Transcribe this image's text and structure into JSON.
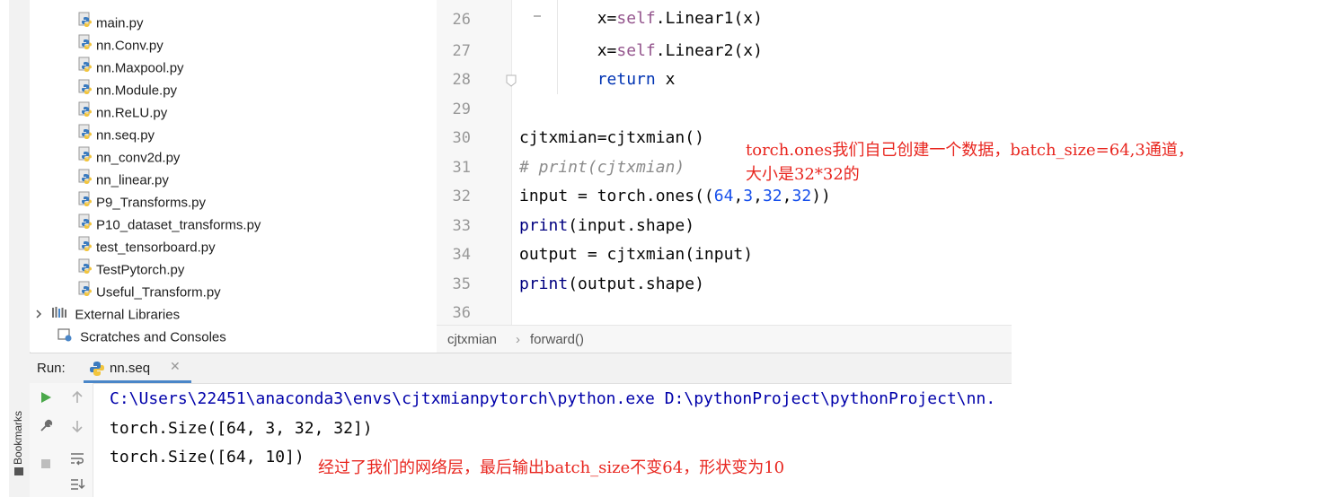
{
  "project_tree": {
    "files": [
      {
        "label": "main.py"
      },
      {
        "label": "nn.Conv.py"
      },
      {
        "label": "nn.Maxpool.py"
      },
      {
        "label": "nn.Module.py"
      },
      {
        "label": "nn.ReLU.py"
      },
      {
        "label": "nn.seq.py"
      },
      {
        "label": "nn_conv2d.py"
      },
      {
        "label": "nn_linear.py"
      },
      {
        "label": "P9_Transforms.py"
      },
      {
        "label": "P10_dataset_transforms.py"
      },
      {
        "label": "test_tensorboard.py"
      },
      {
        "label": "TestPytorch.py"
      },
      {
        "label": "Useful_Transform.py"
      }
    ],
    "external_libraries": "External Libraries",
    "scratches": "Scratches and Consoles"
  },
  "editor": {
    "line_numbers": [
      "26",
      "27",
      "28",
      "29",
      "30",
      "31",
      "32",
      "33",
      "34",
      "35",
      "36"
    ],
    "code": {
      "l26_indent": "        ",
      "l26_var": "x=",
      "l26_self": "self",
      "l26_rest": ".Linear1(x)",
      "l27_indent": "        ",
      "l27_var": "x=",
      "l27_self": "self",
      "l27_rest": ".Linear2(x)",
      "l28_indent": "        ",
      "l28_kw": "return",
      "l28_rest": " x",
      "l30": "cjtxmian=cjtxmian()",
      "l31": "# print(cjtxmian)",
      "l32_a": "input = torch.ones((",
      "l32_n1": "64",
      "l32_c1": ",",
      "l32_n2": "3",
      "l32_c2": ",",
      "l32_n3": "32",
      "l32_c3": ",",
      "l32_n4": "32",
      "l32_b": "))",
      "l33_fn": "print",
      "l33_rest": "(input.shape)",
      "l34": "output = cjtxmian(input)",
      "l35_fn": "print",
      "l35_rest": "(output.shape)"
    }
  },
  "breadcrumb": {
    "class": "cjtxmian",
    "separator": "›",
    "method": "forward()"
  },
  "run_panel": {
    "label": "Run:",
    "tab": "nn.seq",
    "console": [
      "C:\\Users\\22451\\anaconda3\\envs\\cjtxmianpytorch\\python.exe D:\\pythonProject\\pythonProject\\nn.",
      "torch.Size([64, 3, 32, 32])",
      "torch.Size([64, 10])"
    ]
  },
  "side_label": "Bookmarks",
  "annotations": {
    "top_line1": "torch.ones我们自己创建一个数据，batch_size=64,3通道，",
    "top_line2": "大小是32*32的",
    "bottom": "经过了我们的网络层，最后输出batch_size不变64，形状变为10"
  },
  "colors": {
    "keyword": "#0033b3",
    "self": "#94558d",
    "number": "#1750eb",
    "comment": "#8c8c8c",
    "console_path": "#0000aa",
    "annotation": "#e8261f"
  }
}
